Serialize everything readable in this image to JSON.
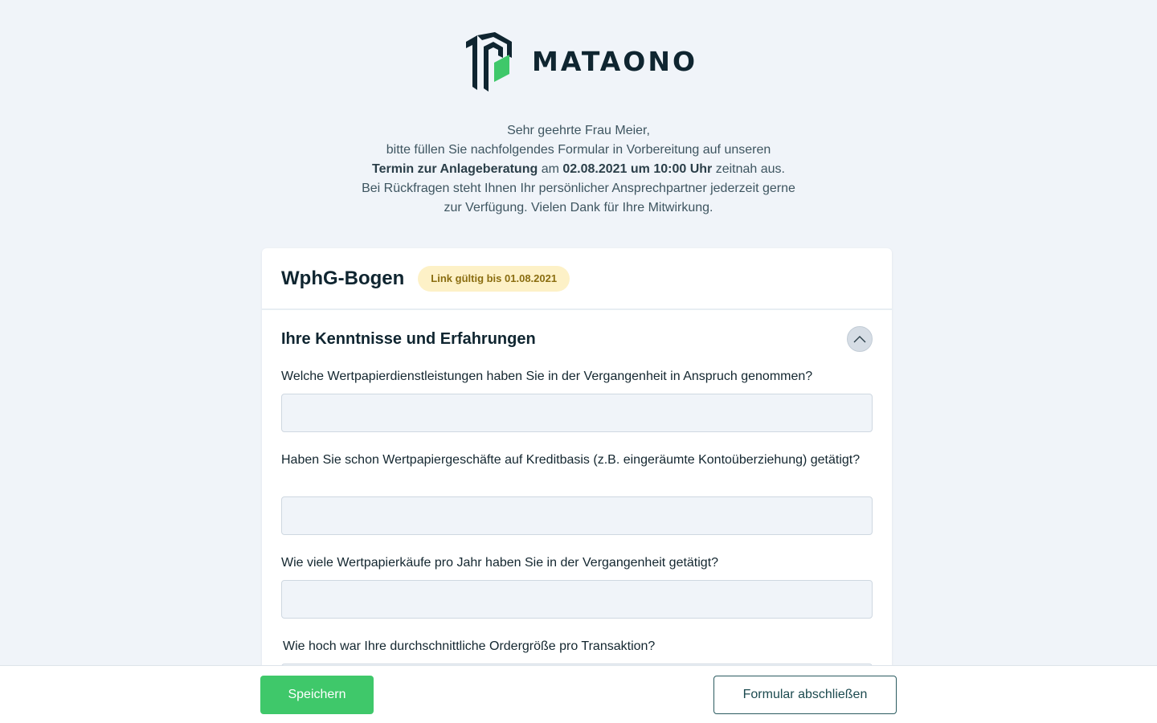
{
  "brand": {
    "name": "MATAONO",
    "logo_icon": "mataono-logo-icon",
    "colors": {
      "dark": "#0f2530",
      "green": "#3fc86a"
    }
  },
  "intro": {
    "line1": "Sehr geehrte Frau Meier,",
    "line2": "bitte füllen Sie nachfolgendes Formular in Vorbereitung auf unseren",
    "line3_bold1": "Termin zur Anlageberatung",
    "line3_text1": " am ",
    "line3_bold2": "02.08.2021 um 10:00 Uhr",
    "line3_text2": " zeitnah aus.",
    "line4": "Bei Rückfragen steht Ihnen Ihr persönlicher Ansprechpartner jederzeit gerne",
    "line5": "zur Verfügung. Vielen Dank für Ihre Mitwirkung."
  },
  "card": {
    "title": "WphG-Bogen",
    "badge": "Link gültig bis 01.08.2021",
    "badge_color": "#fdf1c7"
  },
  "section": {
    "title": "Ihre Kenntnisse und Erfahrungen",
    "toggle_icon": "chevron-up-icon"
  },
  "questions": [
    {
      "label": "Welche Wertpapierdienstleistungen haben Sie in der Vergangenheit in Anspruch genommen?",
      "value": ""
    },
    {
      "label": "Haben Sie schon Wertpapiergeschäfte auf Kreditbasis (z.B. eingeräumte Kontoüberziehung) getätigt?",
      "value": ""
    },
    {
      "label": "Wie viele Wertpapierkäufe pro Jahr haben Sie in der Vergangenheit getätigt?",
      "value": ""
    },
    {
      "label": "Wie hoch war Ihre durchschnittliche Ordergröße pro Transaktion?",
      "value": ""
    }
  ],
  "footer": {
    "save_label": "Speichern",
    "finish_label": "Formular abschließen"
  }
}
